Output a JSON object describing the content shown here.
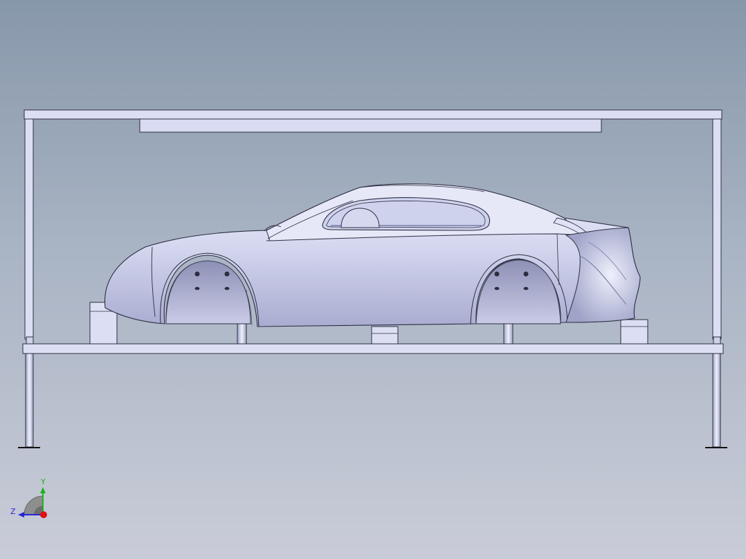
{
  "viewport": {
    "background_top": "#8797aa",
    "background_bottom": "#c9ccd8"
  },
  "model": {
    "part_fill": "#dcdff3",
    "part_edge": "#2b2d40",
    "body_shade": "#b4b7d8"
  },
  "triad": {
    "y_label": "Y",
    "z_label": "Z",
    "y_color": "#1fb31f",
    "z_color": "#2525d6",
    "x_color": "#e01010",
    "icon": "view-orientation-triad-icon"
  }
}
